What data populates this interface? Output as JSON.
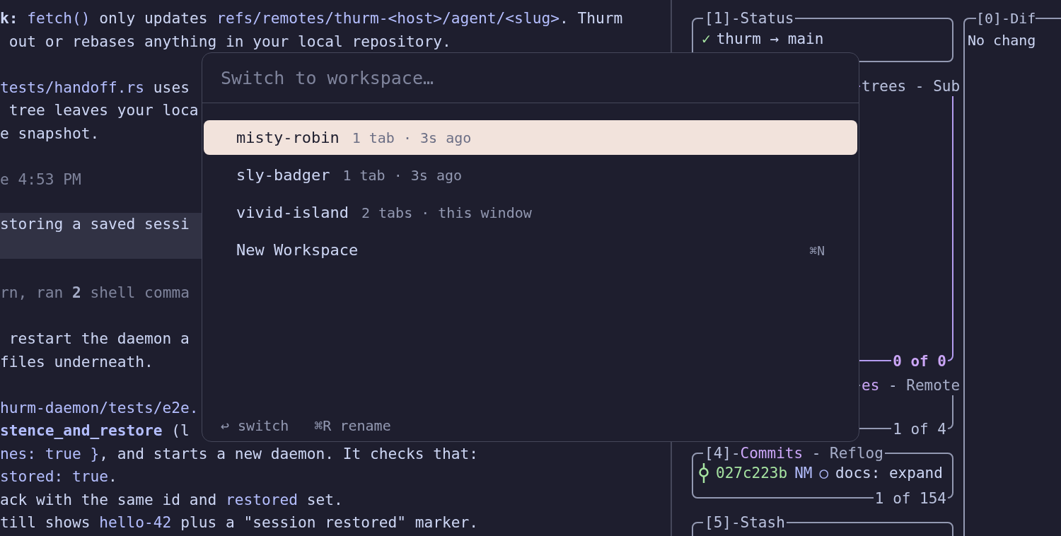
{
  "transcript": {
    "blocks": [
      {
        "kind": "text",
        "lines": [
          [
            {
              "text": "k:",
              "kind": "bold"
            },
            {
              "text": " fetch()",
              "kind": "code"
            },
            {
              "text": " only updates ",
              "kind": "plain"
            },
            {
              "text": "refs/remotes/thurm-<host>/agent/<slug>",
              "kind": "code"
            },
            {
              "text": ". Thurm",
              "kind": "plain"
            }
          ],
          [
            {
              "text": " out or rebases anything in your local repository.",
              "kind": "plain"
            }
          ]
        ]
      },
      {
        "kind": "text",
        "lines": [
          [
            {
              "text": "tests/handoff.rs",
              "kind": "code"
            },
            {
              "text": " uses",
              "kind": "plain"
            }
          ],
          [
            {
              "text": " tree leaves your loca",
              "kind": "plain"
            }
          ],
          [
            {
              "text": "e snapshot.",
              "kind": "plain"
            }
          ]
        ]
      },
      {
        "kind": "text",
        "lines": [
          [
            {
              "text": "e 4:53 PM",
              "kind": "dim"
            }
          ]
        ]
      },
      {
        "kind": "highlight",
        "lines": [
          [
            {
              "text": "storing a saved sessi",
              "kind": "plain"
            }
          ]
        ]
      },
      {
        "kind": "text",
        "lines": [
          [
            {
              "text": "rn, ran ",
              "kind": "dim"
            },
            {
              "text": "2",
              "kind": "dim_bold"
            },
            {
              "text": " shell comma",
              "kind": "dim"
            }
          ]
        ]
      },
      {
        "kind": "text",
        "lines": [
          [
            {
              "text": " restart the daemon a",
              "kind": "plain"
            }
          ],
          [
            {
              "text": "files underneath.",
              "kind": "plain"
            }
          ]
        ]
      },
      {
        "kind": "text",
        "lines": [
          [
            {
              "text": "hurm-daemon/tests/e2e.",
              "kind": "code"
            }
          ],
          [
            {
              "text": "stence_and_restore",
              "kind": "bold_code"
            },
            {
              "text": " (l",
              "kind": "plain"
            }
          ],
          [
            {
              "text": "nes: true }",
              "kind": "code"
            },
            {
              "text": ", and starts a new daemon. It checks that:",
              "kind": "plain"
            }
          ],
          [
            {
              "text": "stored: true",
              "kind": "code"
            },
            {
              "text": ".",
              "kind": "plain"
            }
          ],
          [
            {
              "text": "ack with the same id and ",
              "kind": "plain"
            },
            {
              "text": "restored",
              "kind": "code"
            },
            {
              "text": " set.",
              "kind": "plain"
            }
          ],
          [
            {
              "text": "till shows ",
              "kind": "plain"
            },
            {
              "text": "hello-42",
              "kind": "code"
            },
            {
              "text": " plus a \"session restored\" marker.",
              "kind": "plain"
            }
          ]
        ]
      }
    ]
  },
  "right_panels": [
    {
      "title": "[1]-Status",
      "focused": false,
      "content": {
        "kind": "status",
        "icon": "✓",
        "text": "thurm → main"
      }
    },
    {
      "title": "trees - Sub",
      "focused": true,
      "footer": "0 of 0"
    },
    {
      "title_tabs": [
        {
          "label": "es",
          "selected": true
        },
        {
          "label": "Remote",
          "selected": false
        }
      ],
      "tab_separator": " - ",
      "focused": false,
      "footer": "1 of 4"
    },
    {
      "title_prefix": "[4]-",
      "title_tabs": [
        {
          "label": "Commits",
          "selected": true
        },
        {
          "label": "Reflog",
          "selected": false
        }
      ],
      "tab_separator": " - ",
      "focused": false,
      "content": {
        "kind": "commit",
        "hash": "027c223b",
        "author": "NM",
        "marker": "○",
        "message": "docs: expand"
      },
      "footer": "1 of 154"
    },
    {
      "title": "[5]-Stash",
      "focused": false
    }
  ],
  "diff_panel": {
    "title": "[0]-Dif",
    "text": "No chang"
  },
  "workspace_switcher": {
    "search": {
      "placeholder": "Switch to workspace…"
    },
    "items": [
      {
        "kind": "workspace",
        "name": "misty-robin",
        "meta": "1 tab · 3s ago",
        "selected": true
      },
      {
        "kind": "workspace",
        "name": "sly-badger",
        "meta": "1 tab · 3s ago",
        "selected": false
      },
      {
        "kind": "workspace",
        "name": "vivid-island",
        "meta": "2 tabs · this window",
        "selected": false
      },
      {
        "kind": "action",
        "name": "New Workspace",
        "shortcut": "⌘N",
        "selected": false
      }
    ],
    "hints": [
      "↩ switch",
      "⌘R rename"
    ]
  }
}
